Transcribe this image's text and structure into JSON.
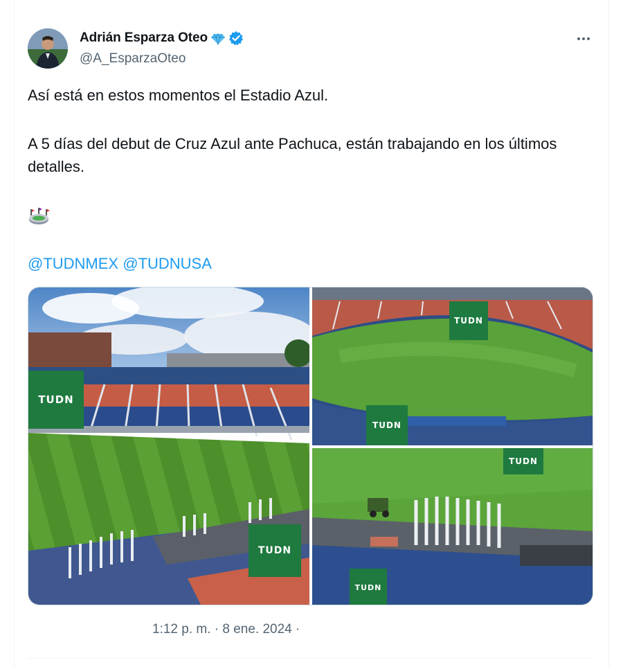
{
  "author": {
    "display_name": "Adrián Esparza Oteo",
    "handle": "@A_EsparzaOteo",
    "badge_icon": "diamond-icon",
    "verified_icon": "verified-badge-icon"
  },
  "menu": {
    "more_icon": "more-options-icon"
  },
  "tweet": {
    "line1": "Así está en estos momentos el Estadio Azul.",
    "line2": "A 5 días del debut de Cruz Azul ante Pachuca, están trabajando en los últimos detalles.",
    "emoji_icon": "stadium-emoji-icon",
    "mentions": [
      "@TUDNMEX",
      "@TUDNUSA"
    ]
  },
  "media": {
    "watermark": "TUDN",
    "photos": [
      "stadium-stands-photo",
      "stadium-field-photo",
      "stadium-sideline-photo"
    ]
  },
  "meta": {
    "timestamp": "1:12 p. m. · 8 ene. 2024 ·"
  },
  "colors": {
    "link": "#1d9bf0",
    "verified": "#1d9bf0",
    "grass": "#4f9a2e",
    "seats_blue": "#2b4f8f",
    "seats_red": "#c2604a",
    "tudn_green": "#1e7a3f"
  }
}
